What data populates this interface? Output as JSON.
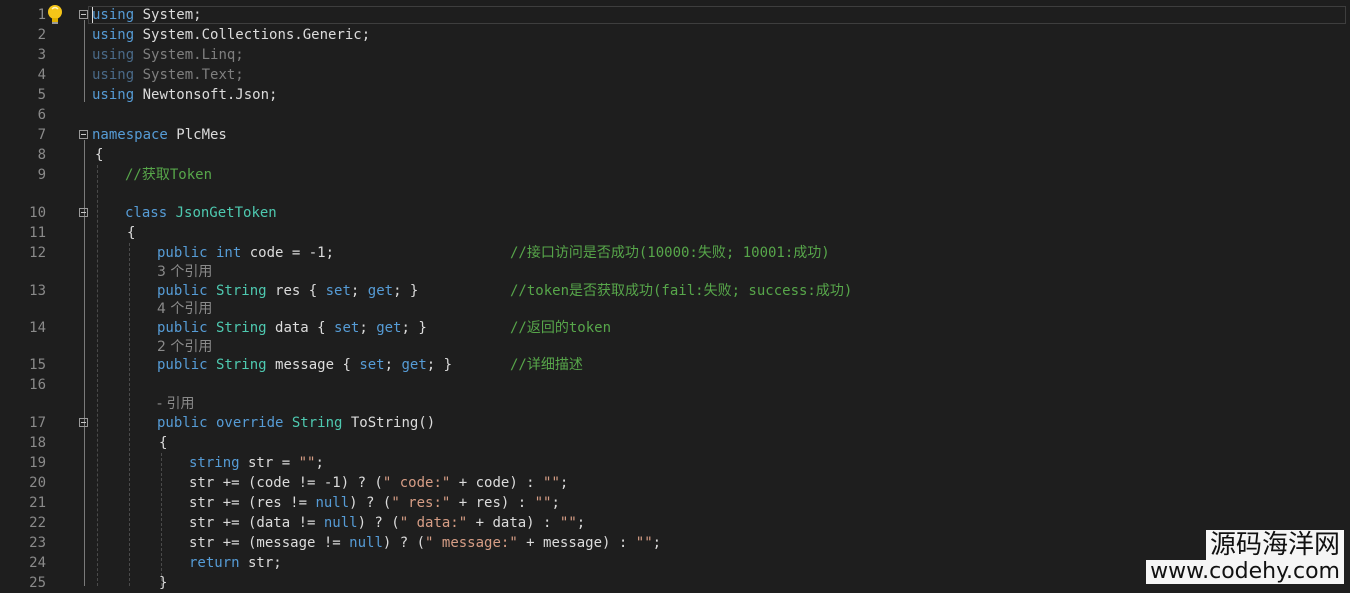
{
  "line_numbers": [
    "1",
    "2",
    "3",
    "4",
    "5",
    "6",
    "7",
    "8",
    "9",
    "10",
    "11",
    "12",
    "13",
    "14",
    "15",
    "16",
    "17",
    "18",
    "19",
    "20",
    "21",
    "22",
    "23",
    "24",
    "25"
  ],
  "code": {
    "l1": {
      "kw": "using",
      "rest": " System;"
    },
    "l2": {
      "kw": "using",
      "rest": " System.Collections.Generic;"
    },
    "l3": {
      "kw": "using",
      "rest": " System.Linq;"
    },
    "l4": {
      "kw": "using",
      "rest": " System.Text;"
    },
    "l5": {
      "kw": "using",
      "rest": " Newtonsoft.Json;"
    },
    "l7": {
      "kw": "namespace",
      "rest": " PlcMes"
    },
    "l8": "{",
    "l9": "//获取Token",
    "l10": {
      "kw": "class",
      "name": " JsonGetToken"
    },
    "l11": "{",
    "l12": {
      "kw1": "public",
      "kw2": " int",
      "rest": " code = -1;",
      "comment": "//接口访问是否成功(10000:失败; 10001:成功)"
    },
    "l13": {
      "kw1": "public",
      "ty": " String",
      "name": " res",
      "rest_a": " { ",
      "set": "set",
      "sep": "; ",
      "get": "get",
      "rest_b": "; }",
      "comment": "//token是否获取成功(fail:失败; success:成功)"
    },
    "l14": {
      "kw1": "public",
      "ty": " String",
      "name": " data",
      "rest_a": " { ",
      "set": "set",
      "sep": "; ",
      "get": "get",
      "rest_b": "; }",
      "comment": "//返回的token"
    },
    "l15": {
      "kw1": "public",
      "ty": " String",
      "name": " message",
      "rest_a": " { ",
      "set": "set",
      "sep": "; ",
      "get": "get",
      "rest_b": "; }",
      "comment": "//详细描述"
    },
    "l17": {
      "kw1": "public",
      "kw2": " override",
      "ty": " String",
      "rest": " ToString()"
    },
    "l18": "{",
    "l19": {
      "kw": "string",
      "rest": " str = ",
      "str": "\"\"",
      "end": ";"
    },
    "l20": {
      "a": "str += (code != -1) ? (",
      "s": "\" code:\"",
      "b": " + code) : ",
      "s2": "\"\"",
      "c": ";"
    },
    "l21": {
      "a": "str += (res != ",
      "k": "null",
      "a2": ") ? (",
      "s": "\" res:\"",
      "b": " + res) : ",
      "s2": "\"\"",
      "c": ";"
    },
    "l22": {
      "a": "str += (data != ",
      "k": "null",
      "a2": ") ? (",
      "s": "\" data:\"",
      "b": " + data) : ",
      "s2": "\"\"",
      "c": ";"
    },
    "l23": {
      "a": "str += (message != ",
      "k": "null",
      "a2": ") ? (",
      "s": "\" message:\"",
      "b": " + message) : ",
      "s2": "\"\"",
      "c": ";"
    },
    "l24": {
      "kw": "return",
      "rest": " str;"
    },
    "l25": "}"
  },
  "codelens": {
    "c13": "3 个引用",
    "c14": "4 个引用",
    "c15": "2 个引用",
    "c17": "- 引用"
  },
  "watermark": {
    "line1": "源码海洋网",
    "line2": "www.codehy.com"
  },
  "icons": {
    "bulb": "lightbulb-icon",
    "fold": "collapse-minus-icon"
  },
  "colors": {
    "background": "#1e1e1e",
    "keyword": "#569cd6",
    "type": "#4ec9b0",
    "comment": "#57a64a",
    "string": "#d69d85",
    "text": "#dcdcdc"
  }
}
